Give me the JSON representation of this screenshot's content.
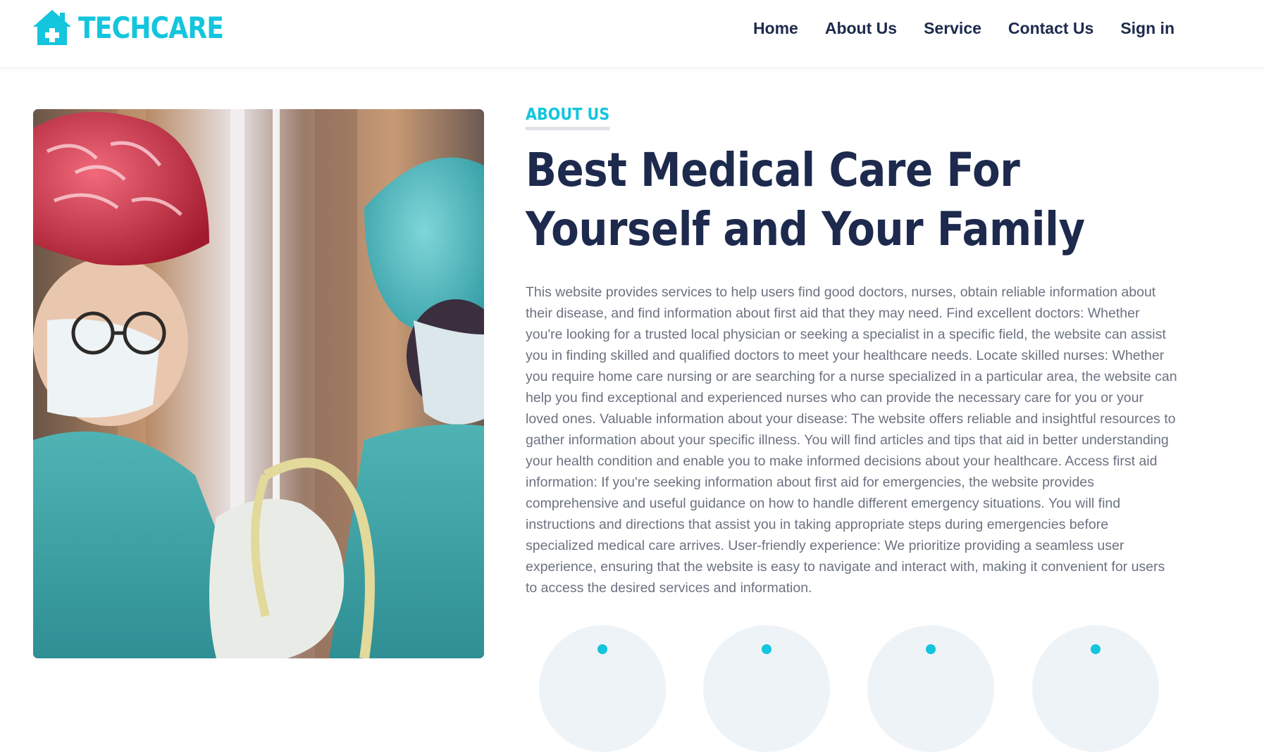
{
  "brand": {
    "name": "TECHCARE",
    "icon": "house-medical-icon",
    "color": "#13c5dd"
  },
  "nav": {
    "items": [
      {
        "label": "Home"
      },
      {
        "label": "About Us"
      },
      {
        "label": "Service"
      },
      {
        "label": "Contact Us"
      },
      {
        "label": "Sign in"
      }
    ]
  },
  "about": {
    "tag": "ABOUT US",
    "headline": "Best Medical Care For Yourself and Your Family",
    "body": "This website provides services to help users find good doctors, nurses, obtain reliable information about their disease, and find information about first aid that they may need. Find excellent doctors: Whether you're looking for a trusted local physician or seeking a specialist in a specific field, the website can assist you in finding skilled and qualified doctors to meet your healthcare needs. Locate skilled nurses: Whether you require home care nursing or are searching for a nurse specialized in a particular area, the website can help you find exceptional and experienced nurses who can provide the necessary care for you or your loved ones. Valuable information about your disease: The website offers reliable and insightful resources to gather information about your specific illness. You will find articles and tips that aid in better understanding your health condition and enable you to make informed decisions about your healthcare. Access first aid information: If you're seeking information about first aid for emergencies, the website provides comprehensive and useful guidance on how to handle different emergency situations. You will find instructions and directions that assist you in taking appropriate steps during emergencies before specialized medical care arrives. User-friendly experience: We prioritize providing a seamless user experience, ensuring that the website is easy to navigate and interact with, making it convenient for users to access the desired services and information."
  },
  "hero_image": {
    "subject": "surgeons-in-operating-room-photo"
  },
  "colors": {
    "primary": "#13c5dd",
    "heading": "#1d2a4d",
    "text": "#6b7280"
  }
}
